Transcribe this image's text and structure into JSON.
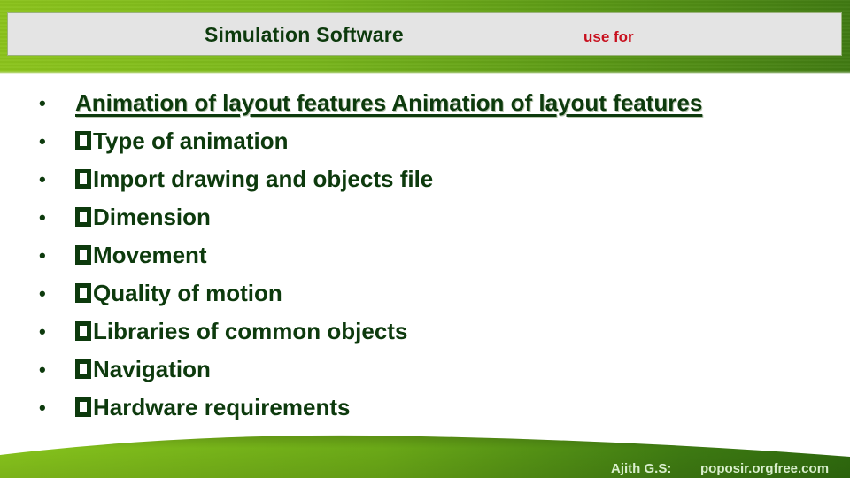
{
  "header": {
    "title": "Simulation Software",
    "subtitle": "use for"
  },
  "bullets": {
    "items": [
      {
        "text": "Animation of layout features Animation of layout features",
        "has_glyph": false
      },
      {
        "text": "Type of animation",
        "has_glyph": true
      },
      {
        "text": "Import drawing and objects file",
        "has_glyph": true
      },
      {
        "text": "Dimension",
        "has_glyph": true
      },
      {
        "text": "Movement",
        "has_glyph": true
      },
      {
        "text": "Quality of motion",
        "has_glyph": true
      },
      {
        "text": "Libraries of common objects",
        "has_glyph": true
      },
      {
        "text": "Navigation",
        "has_glyph": true
      },
      {
        "text": "Hardware requirements",
        "has_glyph": true
      }
    ],
    "bullet_symbol": "•",
    "missing_glyph_icon": "replacement-character-box"
  },
  "footer": {
    "author": "Ajith G.S:",
    "site": "poposir.orgfree.com"
  },
  "colors": {
    "text": "#0d3a0d",
    "accent_red": "#c8101e",
    "title_box": "#e4e4e4",
    "grass_light": "#8cc51a",
    "grass_dark": "#2f6a0e"
  }
}
